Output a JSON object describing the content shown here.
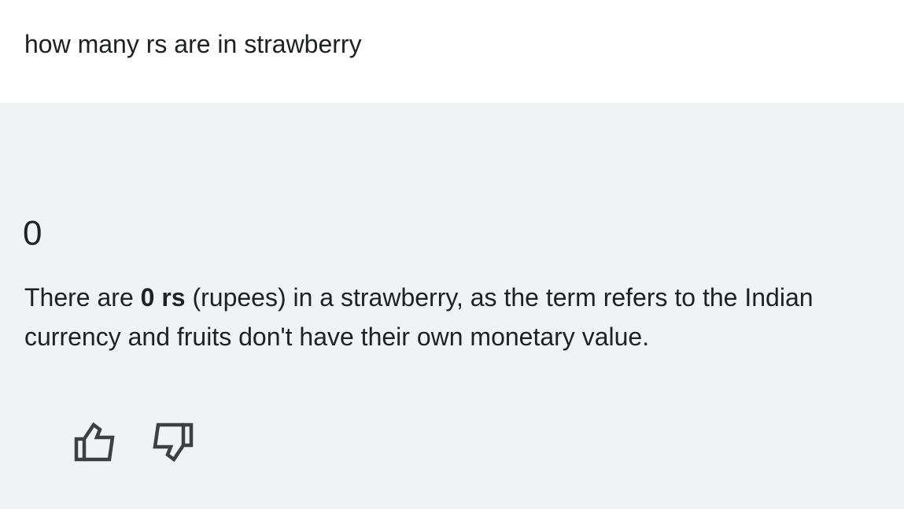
{
  "query": {
    "text": "how many rs are in strawberry"
  },
  "answer": {
    "value": "0",
    "description": {
      "prefix": "There are ",
      "bold": "0 rs",
      "suffix": " (rupees) in a strawberry, as the term refers to the Indian currency and fruits don't have their own monetary value."
    }
  },
  "feedback": {
    "icons": [
      "thumbs-up-icon",
      "thumbs-down-icon"
    ]
  },
  "colors": {
    "query_background": "#ffffff",
    "answer_background": "#f1f2f4",
    "text": "#202124",
    "icon": "#3c4043"
  }
}
